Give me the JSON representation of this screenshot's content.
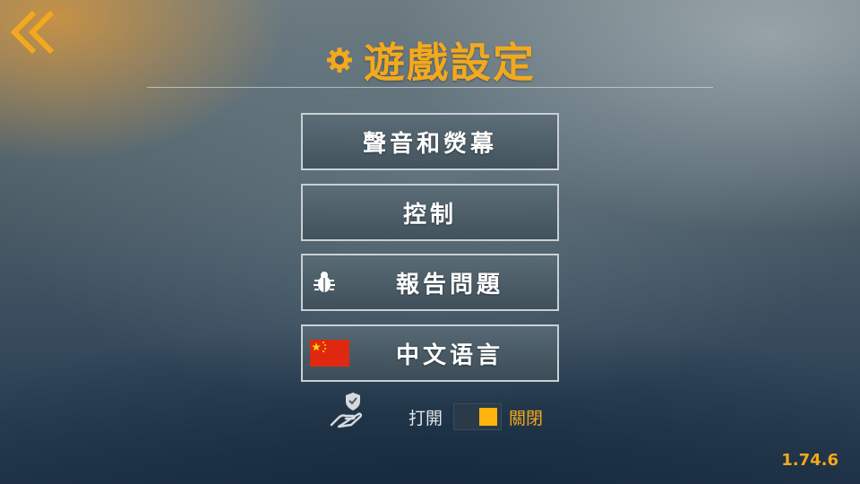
{
  "header": {
    "title": "遊戲設定",
    "back_icon": "double-chevron-left-icon",
    "title_icon": "gear-icon"
  },
  "menu": {
    "items": [
      {
        "label": "聲音和熒幕"
      },
      {
        "label": "控制"
      },
      {
        "label": "報告問題",
        "icon": "bug-icon"
      },
      {
        "label": "中文语言",
        "icon": "china-flag-icon"
      }
    ]
  },
  "privacy": {
    "icon": "shield-hand-icon",
    "on_label": "打開",
    "off_label": "關閉",
    "state": "off"
  },
  "footer": {
    "version": "1.74.6"
  },
  "colors": {
    "accent": "#f2a91e",
    "toggle_knob": "#ffb30b",
    "button_border": "#c9d0d4"
  }
}
